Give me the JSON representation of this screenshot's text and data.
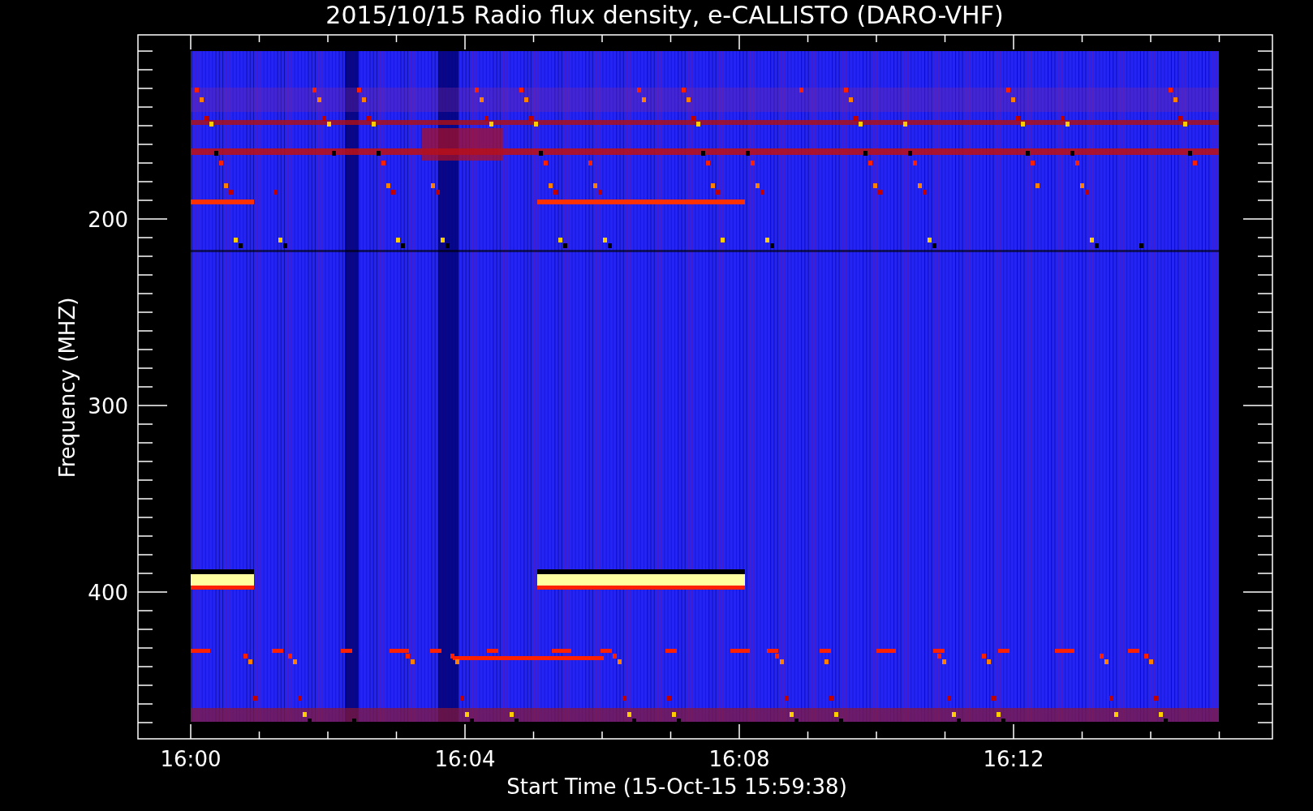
{
  "plot": {
    "title": "2015/10/15  Radio flux density, e-CALLISTO (DARO-VHF)",
    "ylabel": "Frequency (MHZ)",
    "xlabel": "Start Time (15-Oct-15 15:59:38)",
    "yticks": [
      "200",
      "300",
      "400"
    ],
    "xticks": [
      "16:00",
      "16:04",
      "16:08",
      "16:12"
    ]
  }
}
